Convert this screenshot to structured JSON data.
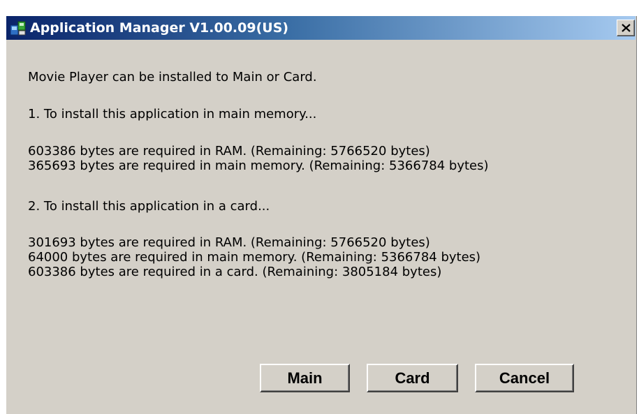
{
  "window": {
    "title": "Application Manager V1.00.09(US)",
    "close_label": "×"
  },
  "message": {
    "intro": "Movie Player can be installed to Main or Card.",
    "option1_heading": "1. To install this application in main memory...",
    "option1_lines": [
      "603386 bytes are required in RAM. (Remaining: 5766520 bytes)",
      "365693 bytes are required in main memory. (Remaining: 5366784 bytes)"
    ],
    "option2_heading": "2. To install this application in a card...",
    "option2_lines": [
      "301693 bytes are required in RAM. (Remaining: 5766520 bytes)",
      "64000 bytes are required in main memory. (Remaining: 5366784 bytes)",
      "603386 bytes are required in a card. (Remaining: 3805184 bytes)"
    ]
  },
  "buttons": {
    "main": "Main",
    "card": "Card",
    "cancel": "Cancel"
  },
  "colors": {
    "title_start": "#0a246a",
    "title_end": "#a6caf0",
    "face": "#d4d0c8"
  },
  "icons": {
    "title": "app-manager-icon",
    "close": "close-icon"
  }
}
